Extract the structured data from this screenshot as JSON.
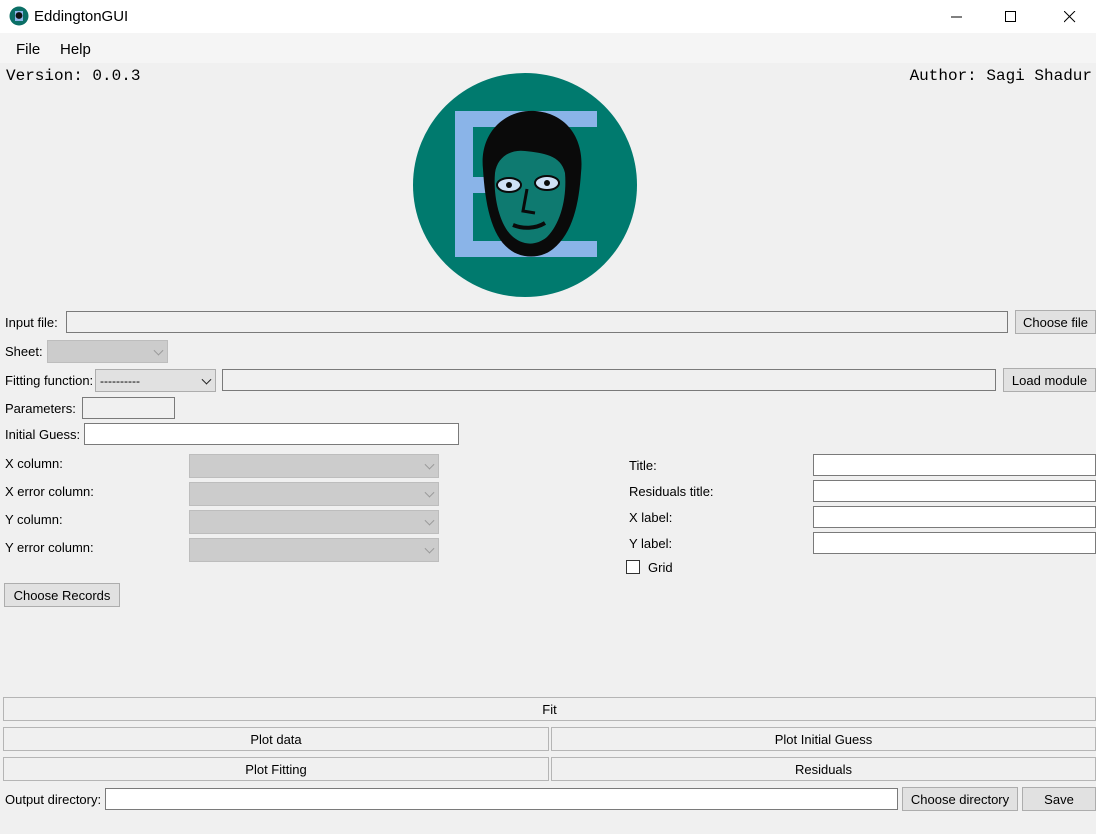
{
  "window": {
    "title": "EddingtonGUI"
  },
  "menu": [
    "File",
    "Help"
  ],
  "header": {
    "version": "Version: 0.0.3",
    "author": "Author: Sagi Shadur"
  },
  "input_file": {
    "label": "Input file:",
    "value": "",
    "button": "Choose file"
  },
  "sheet": {
    "label": "Sheet:",
    "value": ""
  },
  "fitting": {
    "label": "Fitting function:",
    "selected": "----------",
    "module_path": "",
    "button": "Load module"
  },
  "parameters": {
    "label": "Parameters:",
    "value": ""
  },
  "initial_guess": {
    "label": "Initial Guess:",
    "value": ""
  },
  "columns": {
    "x": "X column:",
    "x_err": "X error column:",
    "y": "Y column:",
    "y_err": "Y error column:"
  },
  "plot_options": {
    "title": "Title:",
    "residuals_title": "Residuals title:",
    "x_label": "X label:",
    "y_label": "Y label:",
    "grid": "Grid",
    "grid_checked": false
  },
  "choose_records": "Choose Records",
  "actions": {
    "fit": "Fit",
    "plot_data": "Plot data",
    "plot_initial_guess": "Plot Initial Guess",
    "plot_fitting": "Plot Fitting",
    "residuals": "Residuals"
  },
  "output": {
    "label": "Output directory:",
    "value": "",
    "choose_button": "Choose directory",
    "save_button": "Save"
  },
  "colors": {
    "logo_bg": "#007a6e",
    "logo_letter": "#8ab4e8"
  },
  "icons": {
    "logo": "eddington-portrait-logo"
  }
}
